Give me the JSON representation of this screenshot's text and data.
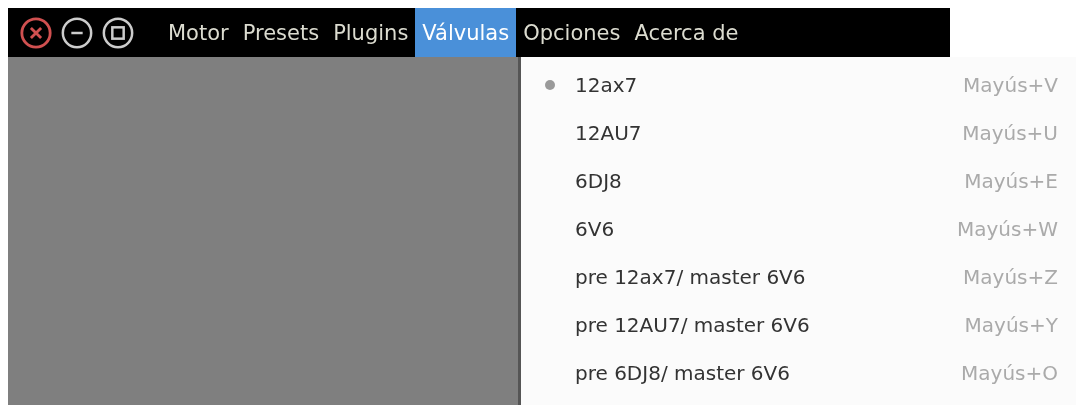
{
  "menubar": [
    {
      "label": "Motor",
      "selected": false
    },
    {
      "label": "Presets",
      "selected": false
    },
    {
      "label": "Plugins",
      "selected": false
    },
    {
      "label": "Válvulas",
      "selected": true
    },
    {
      "label": "Opciones",
      "selected": false
    },
    {
      "label": "Acerca de",
      "selected": false
    }
  ],
  "menu": {
    "items": [
      {
        "label": "12ax7",
        "shortcut": "Mayús+V",
        "selected": true
      },
      {
        "label": "12AU7",
        "shortcut": "Mayús+U",
        "selected": false
      },
      {
        "label": "6DJ8",
        "shortcut": "Mayús+E",
        "selected": false
      },
      {
        "label": "6V6",
        "shortcut": "Mayús+W",
        "selected": false
      },
      {
        "label": "pre 12ax7/ master 6V6",
        "shortcut": "Mayús+Z",
        "selected": false
      },
      {
        "label": "pre 12AU7/ master 6V6",
        "shortcut": "Mayús+Y",
        "selected": false
      },
      {
        "label": "pre 6DJ8/ master 6V6",
        "shortcut": "Mayús+O",
        "selected": false
      }
    ]
  }
}
